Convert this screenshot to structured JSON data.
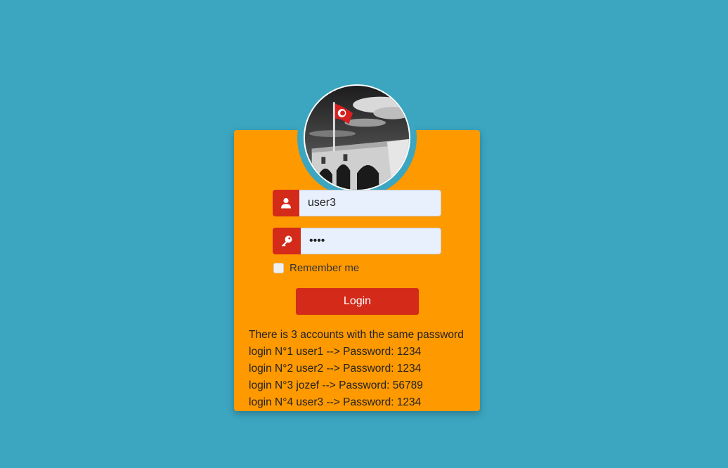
{
  "form": {
    "username_value": "user3",
    "password_value": "1234",
    "remember_label": "Remember me",
    "login_label": "Login"
  },
  "icons": {
    "username": "user-icon",
    "password": "key-icon",
    "avatar": "profile-photo-flag-building"
  },
  "info": {
    "heading": "There is 3 accounts with the same password",
    "lines": [
      "login N°1 user1 --> Password: 1234",
      "login N°2 user2 --> Password: 1234",
      "login N°3 jozef --> Password: 56789",
      "login N°4 user3 --> Password: 1234"
    ]
  },
  "colors": {
    "background": "#3ca5bf",
    "card": "#ff9900",
    "accent": "#d42a1a",
    "input_bg": "#e8f0fe"
  }
}
